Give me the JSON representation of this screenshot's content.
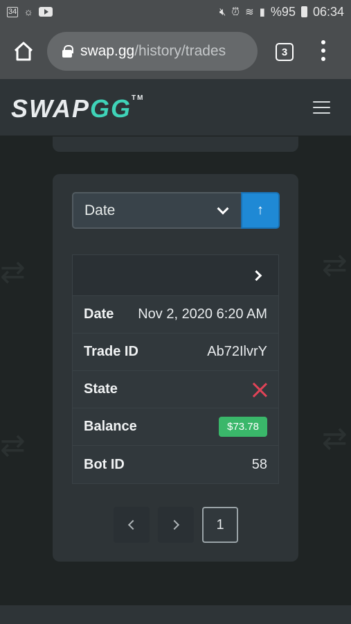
{
  "status_bar": {
    "notif_badge": "34",
    "battery_text": "%95",
    "time": "06:34",
    "icons": [
      "photo-icon",
      "weather-icon",
      "youtube-icon",
      "mute-icon",
      "alarm-icon",
      "wifi-icon",
      "signal-icon",
      "battery-icon"
    ]
  },
  "browser": {
    "url_domain": "swap.gg",
    "url_path": "/history/trades",
    "tab_count": "3"
  },
  "site": {
    "logo_main": "SWAP",
    "logo_accent": "GG",
    "logo_tm": "TM"
  },
  "sort": {
    "selected": "Date",
    "direction_glyph": "↑"
  },
  "trade": {
    "rows": [
      {
        "label": "Date",
        "value": "Nov 2, 2020 6:20 AM"
      },
      {
        "label": "Trade ID",
        "value": "Ab72IlvrY"
      },
      {
        "label": "State",
        "value_icon": "x-icon"
      },
      {
        "label": "Balance",
        "value": "$73.78"
      },
      {
        "label": "Bot ID",
        "value": "58"
      }
    ]
  },
  "pagination": {
    "current_page": "1"
  },
  "colors": {
    "accent_blue": "#1f89d5",
    "success_green": "#3ab76a",
    "error_red": "#e04357",
    "brand_teal": "#3fd3b8"
  }
}
